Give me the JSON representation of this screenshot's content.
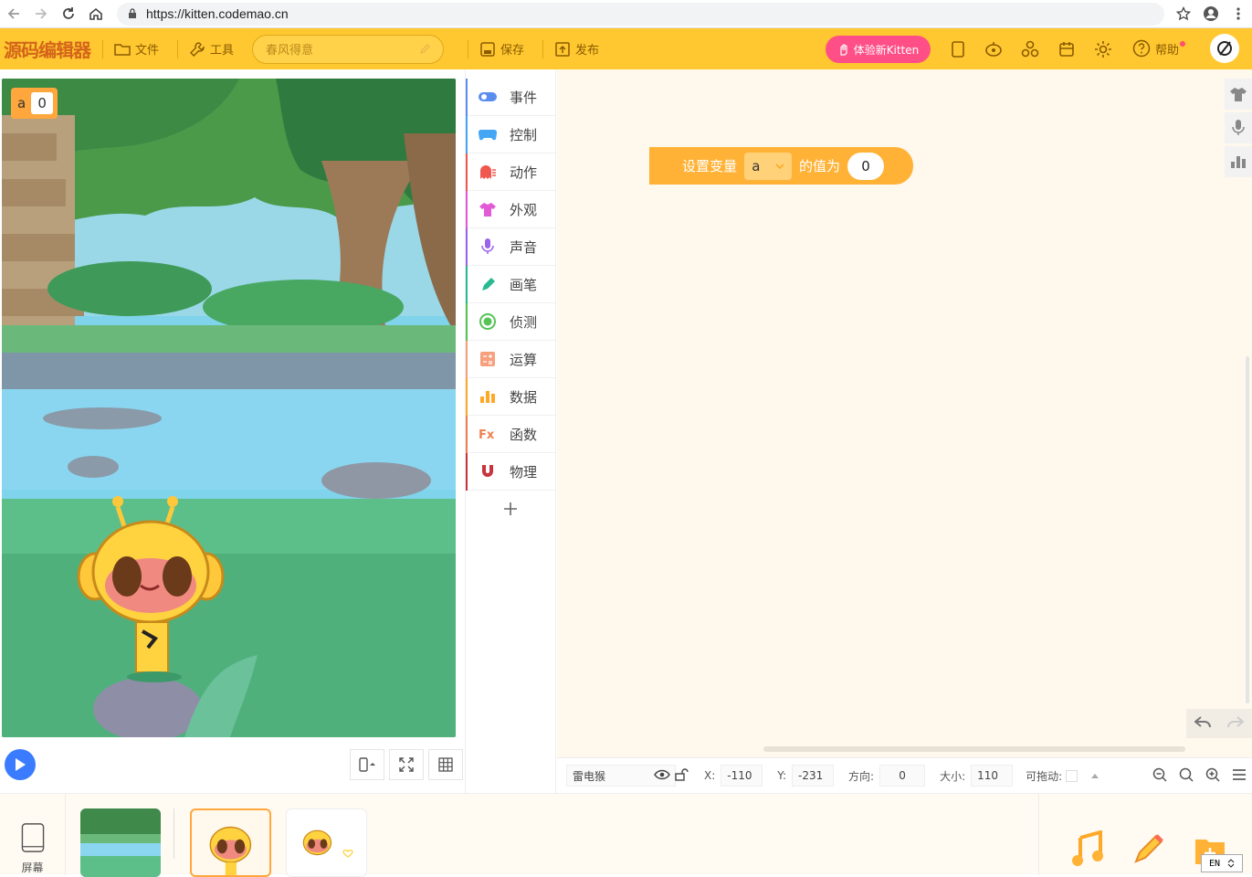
{
  "browser": {
    "url": "https://kitten.codemao.cn"
  },
  "topbar": {
    "logo": "源码编辑器",
    "file_label": "文件",
    "tools_label": "工具",
    "project_title": "春风得意",
    "save_label": "保存",
    "publish_label": "发布",
    "kitten_button": "体验新Kitten",
    "help_label": "帮助"
  },
  "stage": {
    "variable_name": "a",
    "variable_value": "0"
  },
  "categories": [
    {
      "label": "事件",
      "color": "#5b8def"
    },
    {
      "label": "控制",
      "color": "#45a6f5"
    },
    {
      "label": "动作",
      "color": "#f0574f"
    },
    {
      "label": "外观",
      "color": "#e25ad6"
    },
    {
      "label": "声音",
      "color": "#9b63e9"
    },
    {
      "label": "画笔",
      "color": "#26b992"
    },
    {
      "label": "侦测",
      "color": "#55c455"
    },
    {
      "label": "运算",
      "color": "#f7a07e"
    },
    {
      "label": "数据",
      "color": "#ffa826"
    },
    {
      "label": "函数",
      "color": "#f07f4f"
    },
    {
      "label": "物理",
      "color": "#c8343d"
    }
  ],
  "block": {
    "prefix": "设置变量",
    "variable": "a",
    "middle": "的值为",
    "value": "0"
  },
  "properties": {
    "sprite_name": "雷电猴",
    "x_label": "X:",
    "x_value": "-110",
    "y_label": "Y:",
    "y_value": "-231",
    "direction_label": "方向:",
    "direction_value": "0",
    "size_label": "大小:",
    "size_value": "110",
    "draggable_label": "可拖动:"
  },
  "bottom": {
    "screen_label": "屏幕"
  },
  "ime": {
    "label": "EN"
  }
}
